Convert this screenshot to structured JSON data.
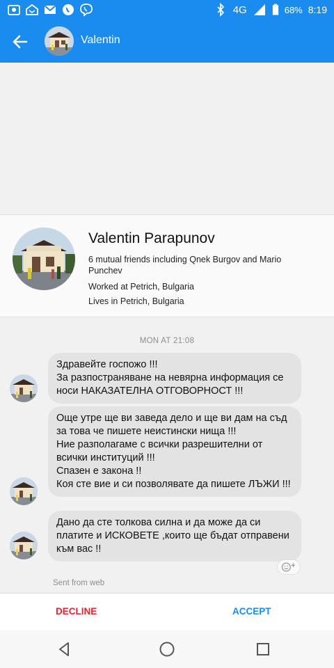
{
  "status_bar": {
    "network": "4G",
    "battery": "68%",
    "time": "8:19",
    "icons": [
      "mail-secure-icon",
      "home-mail-icon",
      "gmail-icon",
      "phone-icon",
      "viber-icon",
      "bluetooth-icon",
      "signal-icon",
      "battery-icon"
    ]
  },
  "header": {
    "title": "Valentin",
    "back_icon": "arrow-left-icon",
    "accent": "#1a8cf0"
  },
  "profile": {
    "name": "Valentin Parapunov",
    "mutual": "6 mutual friends including Qnek Burgov and Mario Punchev",
    "work": "Worked at Petrich, Bulgaria",
    "lives": "Lives in Petrich, Bulgaria"
  },
  "conversation": {
    "date": "MON AT 21:08",
    "messages": [
      {
        "text": "Здравейте госпожо !!!\nЗа разпостраняване на невярна информация се носи НАКАЗАТЕЛНА ОТГОВОРНОСТ !!!"
      },
      {
        "text": "Още утре ще ви заведа дело и ще ви дам на съд за това че пишете неистински нища !!!\nНие разполагаме с всички разрешителни от всички институций !!!\nСпазен е закона !!\nКоя сте вие и си позволявате  да пишете ЛЪЖИ !!!"
      },
      {
        "text": "Дано да сте толкова силна и да може да си платите и ИСКОВЕТЕ  ,които ще бъдат отправени към вас !!"
      }
    ],
    "sent_from": "Sent from web",
    "reaction_icon": "add-reaction-icon"
  },
  "actions": {
    "decline": "DECLINE",
    "accept": "ACCEPT",
    "decline_color": "#e0282c",
    "accept_color": "#1a8cf0"
  },
  "navigation": {
    "icons": [
      "back-triangle-icon",
      "home-circle-icon",
      "recents-square-icon"
    ]
  }
}
